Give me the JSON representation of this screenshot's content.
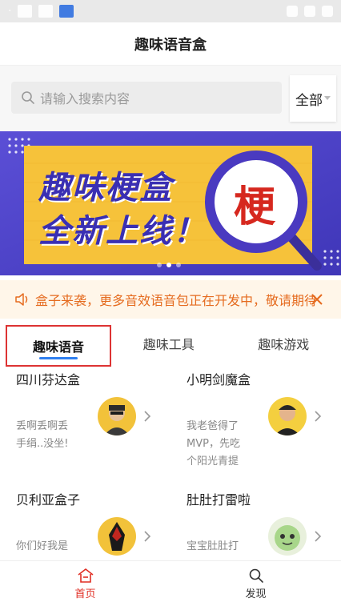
{
  "app": {
    "title": "趣味语音盒"
  },
  "search": {
    "placeholder": "请输入搜索内容",
    "scope": "全部"
  },
  "banner": {
    "line1": "趣味梗盒",
    "line2": "全新上线！",
    "badge": "梗"
  },
  "notice": {
    "text": "盒子来袭，更多音效语音包正在开发中，敬请期待"
  },
  "tabs": [
    {
      "label": "趣味语音"
    },
    {
      "label": "趣味工具"
    },
    {
      "label": "趣味游戏"
    }
  ],
  "items": [
    {
      "name": "四川芬达盒",
      "desc": "丢啊丢啊丢手绢..没坐!"
    },
    {
      "name": "小明剑魔盒",
      "desc": "我老爸得了MVP，先吃个阳光青提"
    },
    {
      "name": "贝利亚盒子",
      "desc": "你们好我是"
    },
    {
      "name": "肚肚打雷啦",
      "desc": "宝宝肚肚打"
    }
  ],
  "nav": [
    {
      "label": "首页"
    },
    {
      "label": "发现"
    }
  ],
  "colors": {
    "accent": "#e02e24",
    "tab_indicator": "#2f7ff0",
    "notice_text": "#e56b1f"
  }
}
